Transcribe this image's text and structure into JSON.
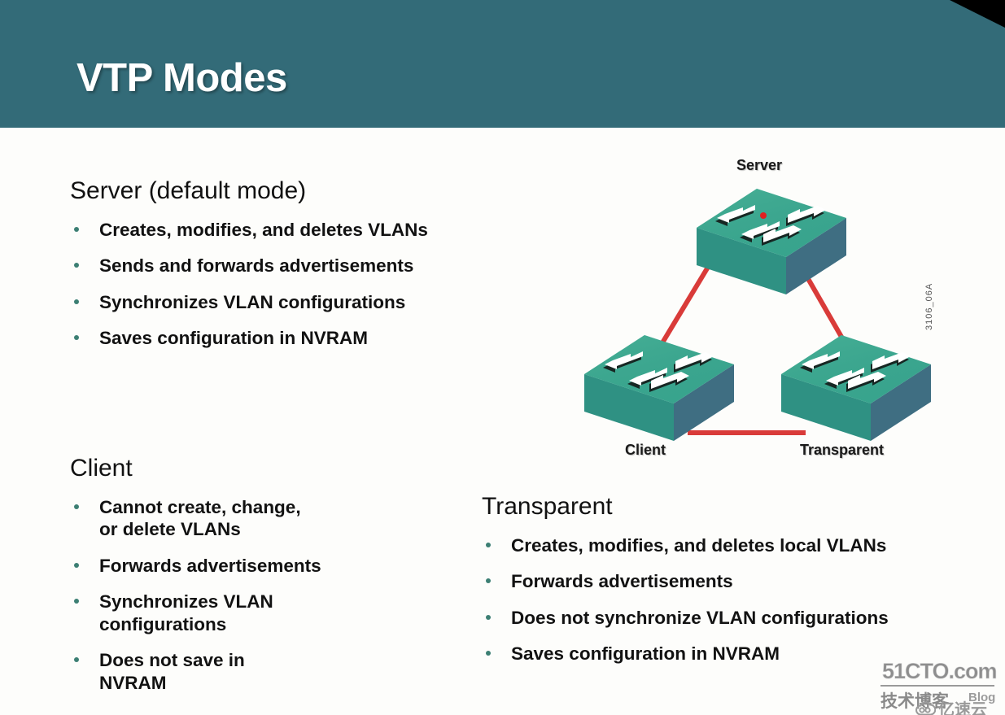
{
  "slide": {
    "title": "VTP Modes",
    "header_color": "#336b78",
    "background_color": "#fdfdfb",
    "corner_accent_color": "#000000"
  },
  "sections": {
    "server": {
      "heading": "Server (default mode)",
      "bullets": [
        [
          "Creates, modifies, and deletes VLANs"
        ],
        [
          "Sends and forwards advertisements"
        ],
        [
          "Synchronizes VLAN configurations"
        ],
        [
          "Saves configuration in NVRAM"
        ]
      ]
    },
    "client": {
      "heading": "Client",
      "bullets": [
        [
          "Cannot create, change,",
          "or delete VLANs"
        ],
        [
          "Forwards advertisements"
        ],
        [
          "Synchronizes VLAN",
          "configurations"
        ],
        [
          "Does not save in",
          "NVRAM"
        ]
      ]
    },
    "transparent": {
      "heading": "Transparent",
      "bullets": [
        [
          "Creates, modifies, and deletes local VLANs"
        ],
        [
          "Forwards advertisements"
        ],
        [
          "Does not synchronize VLAN configurations"
        ],
        [
          "Saves configuration in NVRAM"
        ]
      ]
    }
  },
  "diagram": {
    "nodes": [
      {
        "id": "server",
        "label": "Server"
      },
      {
        "id": "client",
        "label": "Client"
      },
      {
        "id": "transparent",
        "label": "Transparent"
      }
    ],
    "links": [
      {
        "from": "server",
        "to": "client"
      },
      {
        "from": "server",
        "to": "transparent"
      },
      {
        "from": "client",
        "to": "transparent"
      }
    ],
    "art_number": "3106_06A",
    "link_color": "#d93b39",
    "switch_top_color": "#3aa88f",
    "switch_front_color": "#2f9183",
    "switch_side_color": "#3f6e82",
    "status_led_color": "#e02020"
  },
  "watermark": {
    "site": "51CTO.com",
    "cn_text": "技术博客",
    "blog_text": "Blog",
    "cloud_text": "亿速云"
  },
  "bullet_marker_color": "#3c7f73"
}
